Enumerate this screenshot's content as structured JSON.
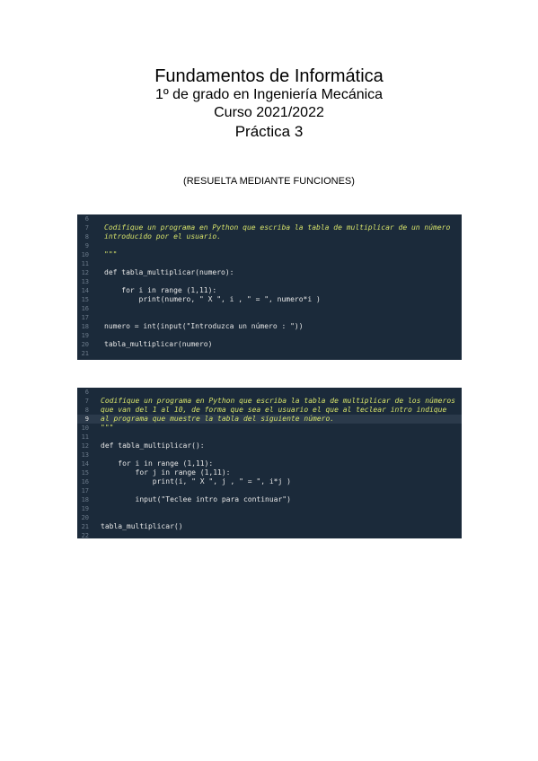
{
  "header": {
    "title": "Fundamentos de Informática",
    "course_line": "1º de grado en Ingeniería Mecánica",
    "year_line": "Curso 2021/2022",
    "practice": "Práctica 3"
  },
  "note": "(RESUELTA MEDIANTE FUNCIONES)",
  "code_block_1": {
    "lines": [
      {
        "n": "6",
        "t": ""
      },
      {
        "n": "7",
        "t": "Codifique un programa en Python que escriba la tabla de multiplicar de un número"
      },
      {
        "n": "8",
        "t": "introducido por el usuario."
      },
      {
        "n": "9",
        "t": ""
      },
      {
        "n": "10",
        "t": "\"\"\""
      },
      {
        "n": "11",
        "t": ""
      },
      {
        "n": "12",
        "t": "def tabla_multiplicar(numero):"
      },
      {
        "n": "13",
        "t": ""
      },
      {
        "n": "14",
        "t": "    for i in range (1,11):"
      },
      {
        "n": "15",
        "t": "        print(numero, \" X \", i , \" = \", numero*i )"
      },
      {
        "n": "16",
        "t": ""
      },
      {
        "n": "17",
        "t": ""
      },
      {
        "n": "18",
        "t": "numero = int(input(\"Introduzca un número : \"))"
      },
      {
        "n": "19",
        "t": ""
      },
      {
        "n": "20",
        "t": "tabla_multiplicar(numero)"
      },
      {
        "n": "21",
        "t": ""
      }
    ]
  },
  "code_block_2": {
    "lines": [
      {
        "n": "6",
        "t": ""
      },
      {
        "n": "7",
        "t": "Codifique un programa en Python que escriba la tabla de multiplicar de los números"
      },
      {
        "n": "8",
        "t": "que van del 1 al 10, de forma que sea el usuario el que al teclear intro indique"
      },
      {
        "n": "9",
        "t": "al programa que muestre la tabla del siguiente número."
      },
      {
        "n": "10",
        "t": "\"\"\""
      },
      {
        "n": "11",
        "t": ""
      },
      {
        "n": "12",
        "t": "def tabla_multiplicar():"
      },
      {
        "n": "13",
        "t": ""
      },
      {
        "n": "14",
        "t": "    for i in range (1,11):"
      },
      {
        "n": "15",
        "t": "        for j in range (1,11):"
      },
      {
        "n": "16",
        "t": "            print(i, \" X \", j , \" = \", i*j )"
      },
      {
        "n": "17",
        "t": ""
      },
      {
        "n": "18",
        "t": "        input(\"Teclee intro para continuar\")"
      },
      {
        "n": "19",
        "t": ""
      },
      {
        "n": "20",
        "t": ""
      },
      {
        "n": "21",
        "t": "tabla_multiplicar()"
      },
      {
        "n": "22",
        "t": ""
      }
    ]
  }
}
